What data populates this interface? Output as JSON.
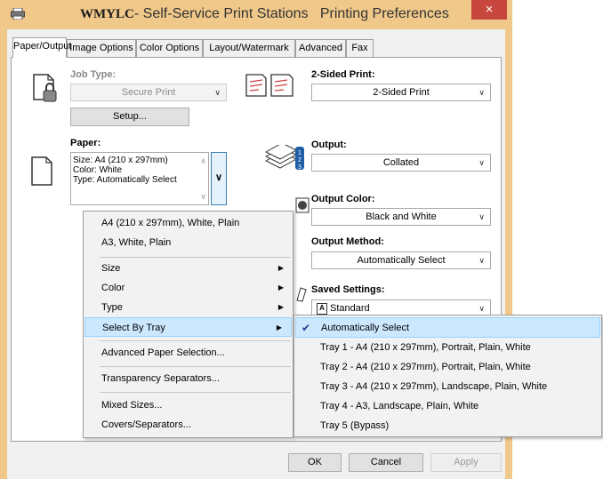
{
  "window": {
    "title_org": "WMYLC",
    "title_rest": "  - Self-Service Print Stations   Printing Preferences",
    "close_glyph": "×"
  },
  "tabs": [
    "Paper/Output",
    "Image Options",
    "Color Options",
    "Layout/Watermark",
    "Advanced",
    "Fax"
  ],
  "left": {
    "job_type_label": "Job Type:",
    "job_type_value": "Secure Print",
    "setup_label": "Setup...",
    "paper_label": "Paper:",
    "paper_lines": [
      "Size: A4 (210 x 297mm)",
      "Color: White",
      "Type: Automatically Select"
    ]
  },
  "right": {
    "two_sided_label": "2-Sided Print:",
    "two_sided_value": "2-Sided Print",
    "output_label": "Output:",
    "output_value": "Collated",
    "output_color_label": "Output Color:",
    "output_color_value": "Black and White",
    "output_method_label": "Output Method:",
    "output_method_value": "Automatically Select",
    "saved_settings_label": "Saved Settings:",
    "saved_settings_value": "Standard",
    "saved_settings_icon_letter": "A"
  },
  "paper_menu": {
    "items": [
      "A4 (210 x 297mm), White, Plain",
      "A3, White, Plain",
      "Size",
      "Color",
      "Type",
      "Select By Tray",
      "Advanced Paper Selection...",
      "Transparency Separators...",
      "Mixed Sizes...",
      "Covers/Separators..."
    ]
  },
  "tray_menu": {
    "check_glyph": "✔",
    "items": [
      "Automatically Select",
      "Tray 1 - A4 (210 x 297mm), Portrait, Plain, White",
      "Tray 2 - A4 (210 x 297mm), Portrait, Plain, White",
      "Tray 3 - A4 (210 x 297mm), Landscape, Plain, White",
      "Tray 4 - A3, Landscape, Plain, White",
      "Tray 5 (Bypass)"
    ]
  },
  "footer": {
    "ok": "OK",
    "cancel": "Cancel",
    "apply": "Apply"
  },
  "colors": {
    "titlebar": "#f0c88a",
    "close": "#c7463d",
    "highlight": "#cce8ff"
  }
}
